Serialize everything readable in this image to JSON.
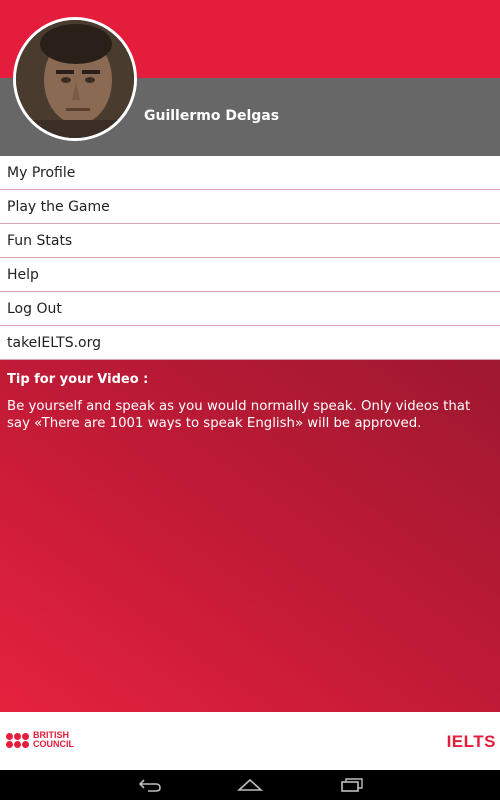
{
  "profile": {
    "name": "Guillermo Delgas"
  },
  "menu": {
    "items": [
      {
        "label": "My Profile"
      },
      {
        "label": "Play the Game"
      },
      {
        "label": "Fun Stats"
      },
      {
        "label": "Help"
      },
      {
        "label": "Log Out"
      },
      {
        "label": "takeIELTS.org"
      }
    ]
  },
  "tip": {
    "title": "Tip for your Video :",
    "body": "Be yourself and speak as you would normally speak. Only videos that say «There are 1001 ways to speak English» will be approved."
  },
  "footer": {
    "british_council_line1": "BRITISH",
    "british_council_line2": "COUNCIL",
    "ielts": "IELTS"
  },
  "navbar": {
    "icons": [
      "back-icon",
      "home-icon",
      "recent-apps-icon"
    ]
  },
  "colors": {
    "accent": "#e31d3b",
    "header_grey": "#676767",
    "navbar": "#000000"
  }
}
